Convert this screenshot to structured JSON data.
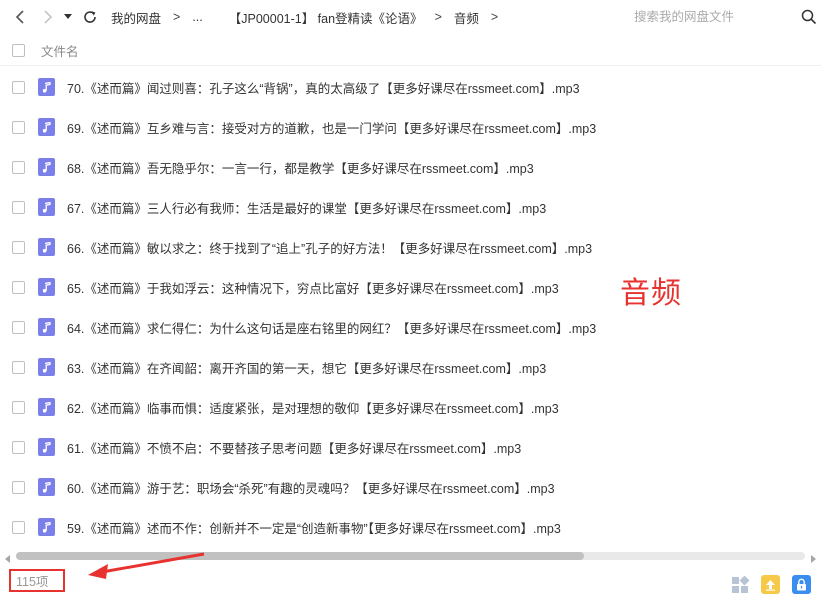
{
  "topbar": {
    "breadcrumb": [
      "我的网盘",
      "...",
      "【JP00001-1】 fan登精读《论语》",
      "音频"
    ],
    "separator": ">",
    "search_placeholder": "搜索我的网盘文件"
  },
  "header": {
    "name_column": "文件名"
  },
  "files": [
    "70.《述而篇》闻过则喜：孔子这么“背锅”，真的太高级了【更多好课尽在rssmeet.com】.mp3",
    "69.《述而篇》互乡难与言：接受对方的道歉，也是一门学问【更多好课尽在rssmeet.com】.mp3",
    "68.《述而篇》吾无隐乎尔：一言一行，都是教学【更多好课尽在rssmeet.com】.mp3",
    "67.《述而篇》三人行必有我师：生活是最好的课堂【更多好课尽在rssmeet.com】.mp3",
    "66.《述而篇》敏以求之：终于找到了“追上”孔子的好方法！【更多好课尽在rssmeet.com】.mp3",
    "65.《述而篇》于我如浮云：这种情况下，穷点比富好【更多好课尽在rssmeet.com】.mp3",
    "64.《述而篇》求仁得仁：为什么这句话是座右铭里的网红？【更多好课尽在rssmeet.com】.mp3",
    "63.《述而篇》在齐闻韶：离开齐国的第一天，想它【更多好课尽在rssmeet.com】.mp3",
    "62.《述而篇》临事而惧：适度紧张，是对理想的敬仰【更多好课尽在rssmeet.com】.mp3",
    "61.《述而篇》不愤不启：不要替孩子思考问题【更多好课尽在rssmeet.com】.mp3",
    "60.《述而篇》游于艺：职场会“杀死”有趣的灵魂吗？【更多好课尽在rssmeet.com】.mp3",
    "59.《述而篇》述而不作：创新并不一定是“创造新事物”【更多好课尽在rssmeet.com】.mp3"
  ],
  "annotation": {
    "label": "音频",
    "color": "#e8322f"
  },
  "status": {
    "item_count": "115项"
  },
  "colors": {
    "file_icon": "#7b80e8",
    "upload_icon": "#f7c948",
    "lock_icon": "#3a8ef0"
  },
  "icons": {
    "file_type": "music-note-icon",
    "upload": "upload-icon",
    "lock": "lock-icon",
    "grid": "grid-view-icon"
  }
}
